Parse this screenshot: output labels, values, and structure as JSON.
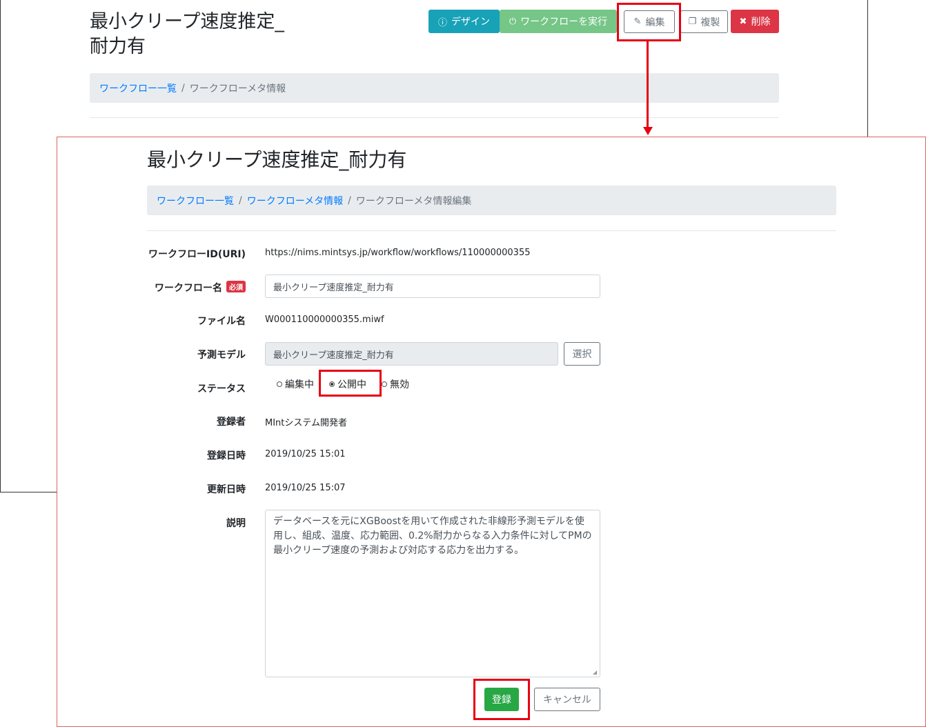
{
  "back": {
    "title_line1": "最小クリープ速度推定_",
    "title_line2": "耐力有",
    "buttons": {
      "design": "デザイン",
      "run": "ワークフローを実行",
      "edit": "編集",
      "copy": "複製",
      "delete": "削除"
    },
    "breadcrumb": {
      "link1": "ワークフロー一覧",
      "sep": "/",
      "current": "ワークフローメタ情報"
    }
  },
  "front": {
    "title": "最小クリープ速度推定_耐力有",
    "breadcrumb": {
      "link1": "ワークフロー一覧",
      "link2": "ワークフローメタ情報",
      "sep": "/",
      "current": "ワークフローメタ情報編集"
    },
    "form": {
      "id_label": "ワークフローID(URI)",
      "id_value": "https://nims.mintsys.jp/workflow/workflows/110000000355",
      "name_label": "ワークフロー名",
      "required_badge": "必須",
      "name_value": "最小クリープ速度推定_耐力有",
      "file_label": "ファイル名",
      "file_value": "W000110000000355.miwf",
      "model_label": "予測モデル",
      "model_value": "最小クリープ速度推定_耐力有",
      "select_button": "選択",
      "status_label": "ステータス",
      "status_options": [
        "編集中",
        "公開中",
        "無効"
      ],
      "status_selected": "公開中",
      "registrant_label": "登録者",
      "registrant_value": "MIntシステム開発者",
      "registered_label": "登録日時",
      "registered_value": "2019/10/25 15:01",
      "updated_label": "更新日時",
      "updated_value": "2019/10/25 15:07",
      "description_label": "説明",
      "description_value": "データベースを元にXGBoostを用いて作成された非線形予測モデルを使用し、組成、温度、応力範囲、0.2%耐力からなる入力条件に対してPMの最小クリープ速度の予測および対応する応力を出力する。"
    },
    "buttons": {
      "register": "登録",
      "cancel": "キャンセル"
    }
  },
  "colors": {
    "highlight": "#e60012",
    "info": "#17a2b8",
    "success_light": "#75c687",
    "danger": "#dc3545",
    "success": "#28a745",
    "link": "#007bff"
  }
}
